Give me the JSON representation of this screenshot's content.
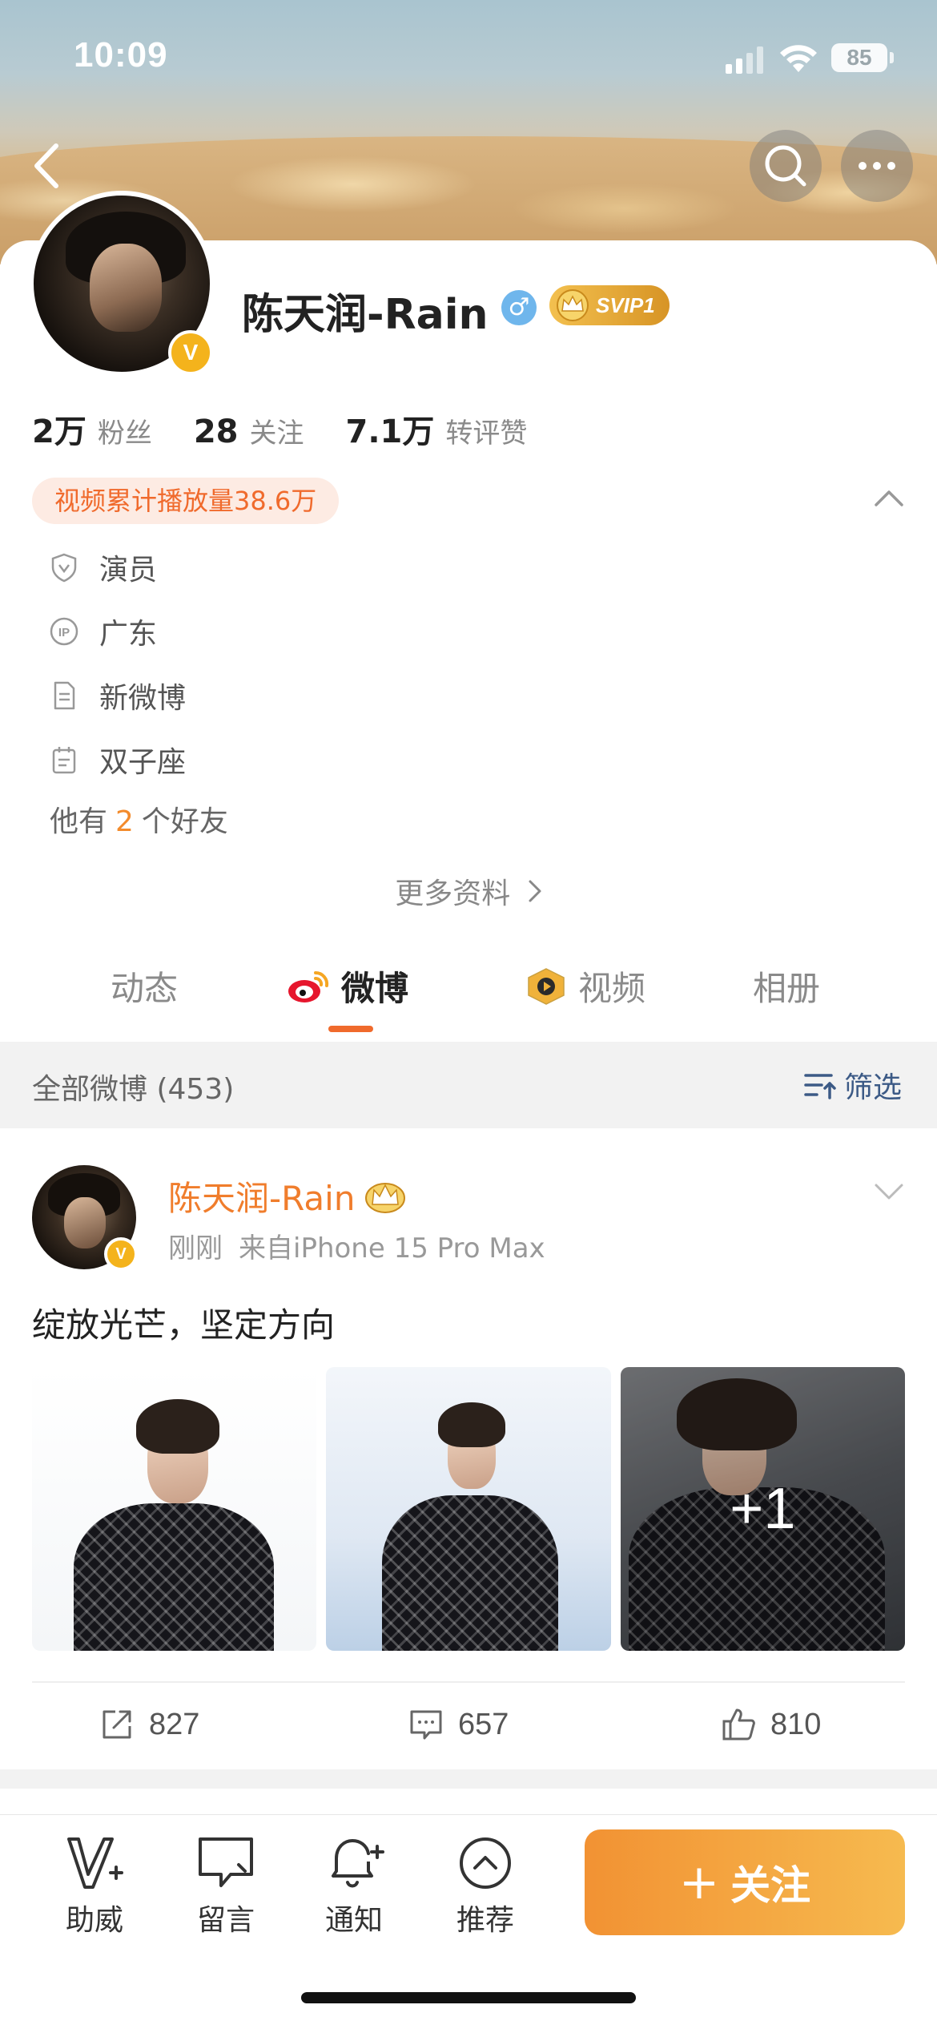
{
  "status_bar": {
    "time": "10:09",
    "battery": "85"
  },
  "profile": {
    "name": "陈天润-Rain",
    "gender_symbol": "♂",
    "svip_badge": "SVIP1",
    "verified_mark": "V",
    "stats": [
      {
        "value": "2万",
        "label": "粉丝"
      },
      {
        "value": "28",
        "label": "关注"
      },
      {
        "value": "7.1万",
        "label": "转评赞"
      }
    ],
    "video_plays": "视频累计播放量38.6万",
    "info": [
      {
        "icon": "shield-icon",
        "text": "演员"
      },
      {
        "icon": "ip-location-icon",
        "text": "广东"
      },
      {
        "icon": "document-icon",
        "text": "新微博"
      },
      {
        "icon": "calendar-icon",
        "text": "双子座"
      }
    ],
    "friends_prefix": "他有",
    "friends_count": "2",
    "friends_suffix": "个好友",
    "more_info": "更多资料"
  },
  "tabs": [
    {
      "label": "动态",
      "active": false
    },
    {
      "label": "微博",
      "active": true
    },
    {
      "label": "视频",
      "active": false
    },
    {
      "label": "相册",
      "active": false
    }
  ],
  "feed": {
    "count_label": "全部微博 (453)",
    "filter_label": "筛选"
  },
  "post": {
    "author": "陈天润-Rain",
    "time": "刚刚",
    "source": "来自iPhone 15 Pro Max",
    "text": "绽放光芒，坚定方向",
    "extra_images": "+1",
    "reposts": "827",
    "comments": "657",
    "likes": "810"
  },
  "bottom_bar": {
    "help": "助威",
    "message": "留言",
    "notify": "通知",
    "recommend": "推荐",
    "follow": "关注",
    "follow_plus": "+"
  },
  "colors": {
    "accent": "#f06a2c",
    "follow_start": "#f29233",
    "follow_end": "#f6ba4f",
    "link_blue": "#3c5a86",
    "verified": "#f4b31c"
  }
}
